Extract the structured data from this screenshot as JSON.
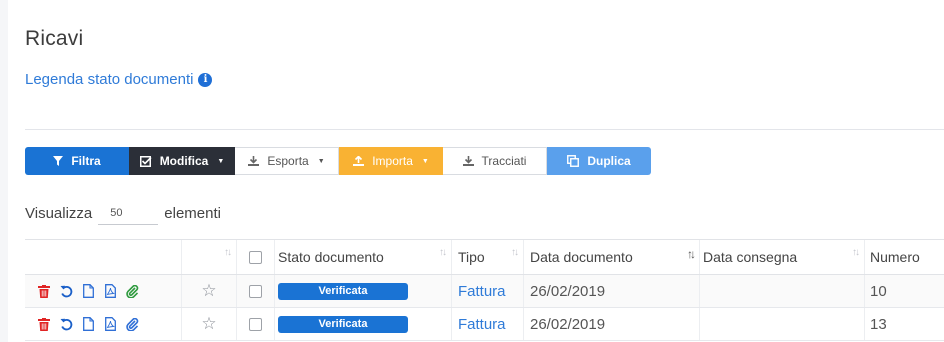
{
  "page": {
    "title": "Ricavi",
    "legend_link": "Legenda stato documenti"
  },
  "toolbar": {
    "filtra": "Filtra",
    "modifica": "Modifica",
    "esporta": "Esporta",
    "importa": "Importa",
    "tracciati": "Tracciati",
    "duplica": "Duplica"
  },
  "paging": {
    "prefix": "Visualizza",
    "page_size": "50",
    "suffix": "elementi"
  },
  "table": {
    "columns": {
      "stato": "Stato documento",
      "tipo": "Tipo",
      "data": "Data documento",
      "consegna": "Data consegna",
      "numero": "Numero"
    },
    "rows": [
      {
        "stato": "Verificata",
        "tipo": "Fattura",
        "data": "26/02/2019",
        "consegna": "",
        "numero": "10"
      },
      {
        "stato": "Verificata",
        "tipo": "Fattura",
        "data": "26/02/2019",
        "consegna": "",
        "numero": "13"
      }
    ]
  },
  "colors": {
    "primary": "#1a73d4",
    "dark": "#2b2f38",
    "warning": "#f9b233",
    "light_blue": "#5aa0ec",
    "delete_red": "#e02424",
    "attach_green": "#2e9a3e"
  }
}
